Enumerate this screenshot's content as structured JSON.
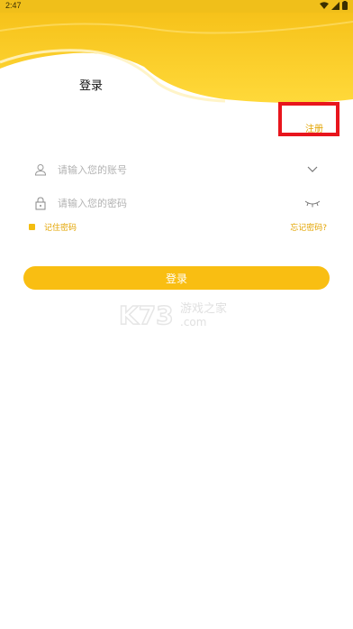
{
  "status_bar": {
    "time": "2:47",
    "icons": [
      "wifi-icon",
      "cellular-signal-icon",
      "battery-icon"
    ],
    "color": "#f0bf1a"
  },
  "header": {
    "title": "登录",
    "accent_color": "#f9be12"
  },
  "register": {
    "label": "注册",
    "highlight_color": "#e8151d"
  },
  "form": {
    "account": {
      "placeholder": "请输入您的账号",
      "icon": "user-icon",
      "trailing_icon": "chevron-down-icon"
    },
    "password": {
      "placeholder": "请输入您的密码",
      "icon": "lock-icon",
      "trailing_icon": "eye-closed-icon"
    },
    "remember_label": "记住密码",
    "forgot_label": "忘记密码?",
    "login_button": "登录"
  },
  "watermark": {
    "brand": "K73",
    "text": "游戏之家",
    "domain": ".com"
  }
}
